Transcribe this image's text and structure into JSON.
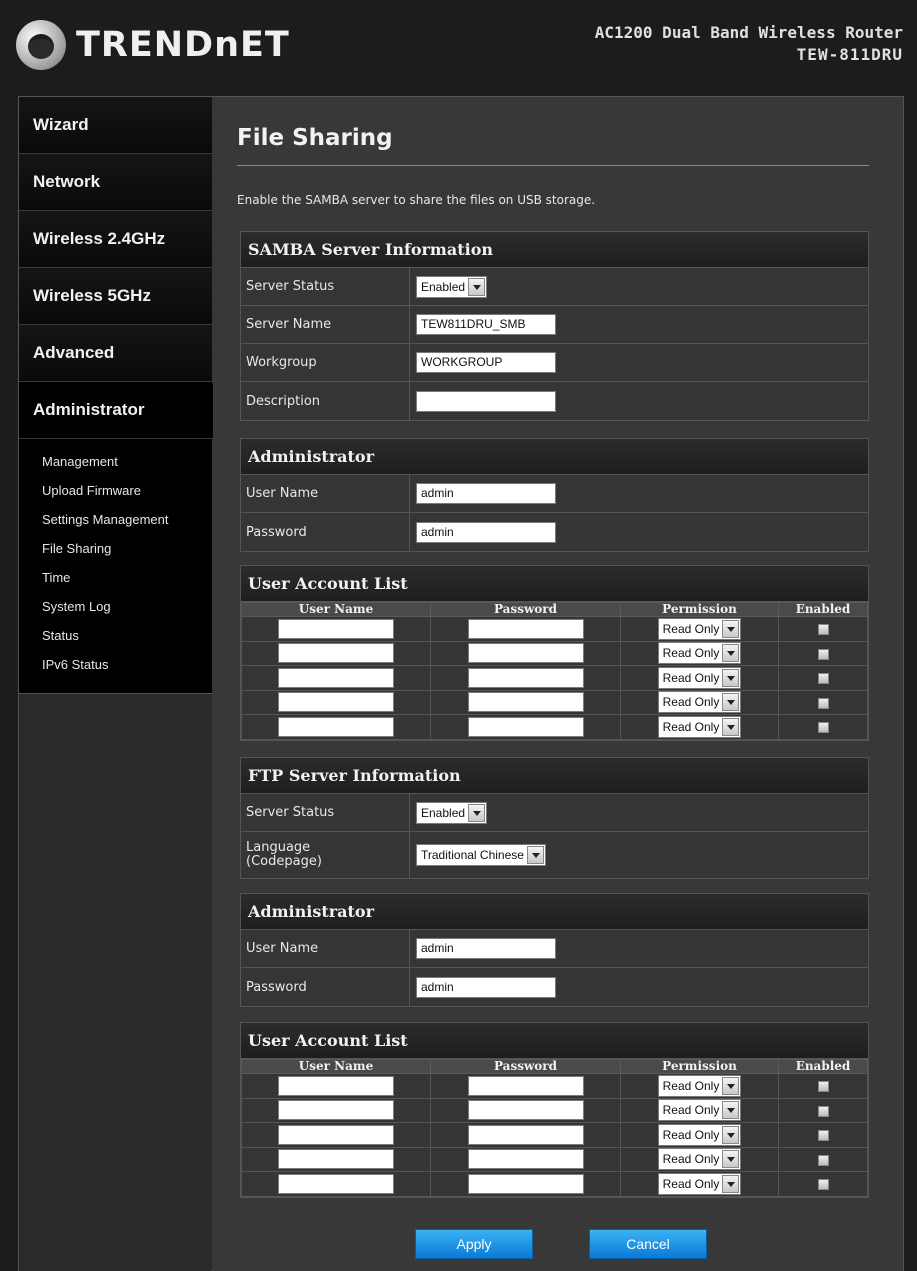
{
  "header": {
    "logo_text": "TRENDnET",
    "product_name": "AC1200 Dual Band Wireless Router",
    "model": "TEW-811DRU"
  },
  "sidebar": {
    "main_items": [
      {
        "label": "Wizard"
      },
      {
        "label": "Network"
      },
      {
        "label": "Wireless 2.4GHz"
      },
      {
        "label": "Wireless 5GHz"
      },
      {
        "label": "Advanced"
      },
      {
        "label": "Administrator",
        "active": true
      }
    ],
    "sub_items": [
      {
        "label": "Management"
      },
      {
        "label": "Upload Firmware"
      },
      {
        "label": "Settings Management"
      },
      {
        "label": "File Sharing"
      },
      {
        "label": "Time"
      },
      {
        "label": "System Log"
      },
      {
        "label": "Status"
      },
      {
        "label": "IPv6 Status"
      }
    ]
  },
  "main": {
    "title": "File Sharing",
    "description": "Enable the SAMBA server to share the files on USB storage.",
    "samba": {
      "heading": "SAMBA Server Information",
      "rows": [
        {
          "label": "Server Status",
          "value": "Enabled"
        },
        {
          "label": "Server Name",
          "value": "TEW811DRU_SMB"
        },
        {
          "label": "Workgroup",
          "value": "WORKGROUP"
        },
        {
          "label": "Description",
          "value": ""
        }
      ]
    },
    "samba_admin": {
      "heading": "Administrator",
      "rows": [
        {
          "label": "User Name",
          "value": "admin"
        },
        {
          "label": "Password",
          "value": "admin"
        }
      ]
    },
    "samba_accounts": {
      "heading": "User Account List",
      "columns": [
        "User Name",
        "Password",
        "Permission",
        "Enabled"
      ],
      "rows": [
        {
          "user": "",
          "password": "",
          "permission": "Read Only"
        },
        {
          "user": "",
          "password": "",
          "permission": "Read Only"
        },
        {
          "user": "",
          "password": "",
          "permission": "Read Only"
        },
        {
          "user": "",
          "password": "",
          "permission": "Read Only"
        },
        {
          "user": "",
          "password": "",
          "permission": "Read Only"
        }
      ]
    },
    "ftp": {
      "heading": "FTP Server Information",
      "rows": [
        {
          "label": "Server Status",
          "value": "Enabled"
        },
        {
          "label": "Language\n(Codepage)",
          "value": "Traditional Chinese"
        }
      ]
    },
    "ftp_admin": {
      "heading": "Administrator",
      "rows": [
        {
          "label": "User Name",
          "value": "admin"
        },
        {
          "label": "Password",
          "value": "admin"
        }
      ]
    },
    "ftp_accounts": {
      "heading": "User Account List",
      "columns": [
        "User Name",
        "Password",
        "Permission",
        "Enabled"
      ],
      "rows": [
        {
          "user": "",
          "password": "",
          "permission": "Read Only"
        },
        {
          "user": "",
          "password": "",
          "permission": "Read Only"
        },
        {
          "user": "",
          "password": "",
          "permission": "Read Only"
        },
        {
          "user": "",
          "password": "",
          "permission": "Read Only"
        },
        {
          "user": "",
          "password": "",
          "permission": "Read Only"
        }
      ]
    },
    "buttons": {
      "apply": "Apply",
      "cancel": "Cancel"
    }
  },
  "colors": {
    "background": "#1c1c1c",
    "content_bg": "#383838",
    "button_blue": "#0a7ad6"
  }
}
